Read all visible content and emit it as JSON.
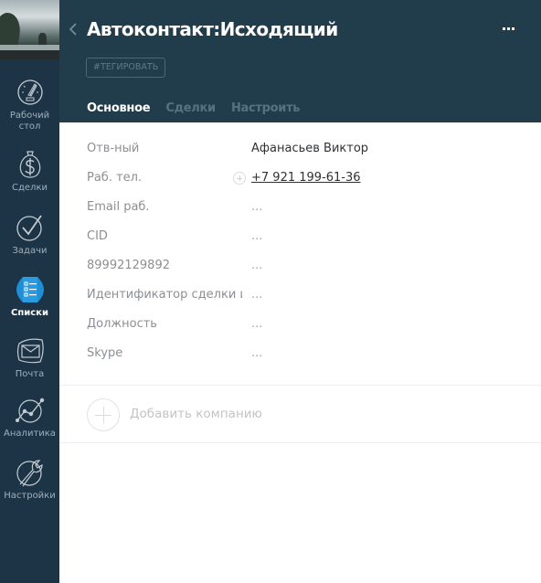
{
  "nav": {
    "items": [
      {
        "label_line1": "Рабочий",
        "label_line2": "стол",
        "icon": "dashboard-gauge-icon",
        "active": false
      },
      {
        "label": "Сделки",
        "icon": "money-bag-icon",
        "active": false
      },
      {
        "label": "Задачи",
        "icon": "checkmark-circle-icon",
        "active": false
      },
      {
        "label": "Списки",
        "icon": "list-icon",
        "active": true
      },
      {
        "label": "Почта",
        "icon": "mail-icon",
        "active": false
      },
      {
        "label": "Аналитика",
        "icon": "analytics-chart-icon",
        "active": false
      },
      {
        "label": "Настройки",
        "icon": "wrench-icon",
        "active": false
      }
    ]
  },
  "header": {
    "title": "Автоконтакт:Исходящий",
    "tag_button": "#ТЕГИРОВАТЬ",
    "tabs": [
      {
        "label": "Основное",
        "active": true
      },
      {
        "label": "Сделки",
        "active": false
      },
      {
        "label": "Настроить",
        "active": false
      }
    ]
  },
  "fields": [
    {
      "name": "Отв-ный",
      "value": "Афанасьев Виктор"
    },
    {
      "name": "Раб. тел.",
      "value": "+7 921 199-61-36"
    },
    {
      "name": "Email раб.",
      "value": "..."
    },
    {
      "name": "CID",
      "value": "..."
    },
    {
      "name": "89992129892",
      "value": "..."
    },
    {
      "name": "Идентификатор сделки и",
      "value": "..."
    },
    {
      "name": "Должность",
      "value": "..."
    },
    {
      "name": "Skype",
      "value": "..."
    }
  ],
  "add_company": {
    "label": "Добавить компанию"
  },
  "colors": {
    "rail": "#1d3446",
    "header": "#213d4b",
    "active_nav": "#1e8fd6"
  }
}
